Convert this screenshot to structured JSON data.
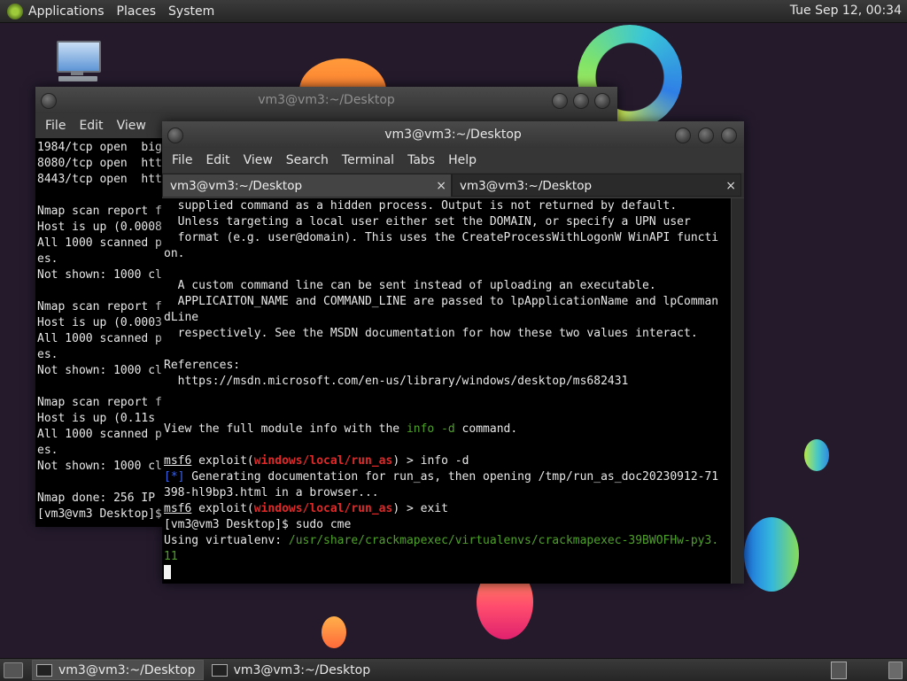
{
  "top_panel": {
    "menus": [
      "Applications",
      "Places",
      "System"
    ],
    "clock": "Tue Sep 12, 00:34"
  },
  "back_window": {
    "title": "vm3@vm3:~/Desktop",
    "menus": [
      "File",
      "Edit",
      "View"
    ],
    "lines": [
      "1984/tcp open  big",
      "8080/tcp open  htt",
      "8443/tcp open  htt",
      "",
      "Nmap scan report f",
      "Host is up (0.0008",
      "All 1000 scanned p",
      "es.",
      "Not shown: 1000 cl",
      "",
      "Nmap scan report f",
      "Host is up (0.0003",
      "All 1000 scanned p",
      "es.",
      "Not shown: 1000 cl",
      "",
      "Nmap scan report f",
      "Host is up (0.11s ",
      "All 1000 scanned p",
      "es.",
      "Not shown: 1000 cl",
      "",
      "Nmap done: 256 IP ",
      "[vm3@vm3 Desktop]$"
    ]
  },
  "front_window": {
    "title": "vm3@vm3:~/Desktop",
    "menus": [
      "File",
      "Edit",
      "View",
      "Search",
      "Terminal",
      "Tabs",
      "Help"
    ],
    "tabs": [
      {
        "label": "vm3@vm3:~/Desktop",
        "close": "×"
      },
      {
        "label": "vm3@vm3:~/Desktop",
        "close": "×"
      }
    ],
    "lines": {
      "l1": "  supplied command as a hidden process. Output is not returned by default.",
      "l2": "  Unless targeting a local user either set the DOMAIN, or specify a UPN user",
      "l3": "  format (e.g. user@domain). This uses the CreateProcessWithLogonW WinAPI functi",
      "l4": "on.",
      "l5": "",
      "l6": "  A custom command line can be sent instead of uploading an executable.",
      "l7": "  APPLICAITON_NAME and COMMAND_LINE are passed to lpApplicationName and lpComman",
      "l8": "dLine",
      "l9": "  respectively. See the MSDN documentation for how these two values interact.",
      "l10": "",
      "l11": "References:",
      "l12": "  https://msdn.microsoft.com/en-us/library/windows/desktop/ms682431",
      "l13": "",
      "l14": "",
      "l15_pre": "View the full module info with the ",
      "l15_cmd": "info -d",
      "l15_post": " command.",
      "l16": "",
      "prompt_msf": "msf6",
      "prompt_exploit": " exploit(",
      "prompt_module": "windows/local/run_as",
      "prompt_end": ") > ",
      "cmd1": "info -d",
      "gen_tag": "[*]",
      "gen_text": " Generating documentation for run_as, then opening /tmp/run_as_doc20230912-71",
      "gen_text2": "398-hl9bp3.html in a browser...",
      "cmd2": "exit",
      "shell_prompt": "[vm3@vm3 Desktop]$ sudo cme",
      "venv_label": "Using virtualenv: ",
      "venv_path": "/usr/share/crackmapexec/virtualenvs/crackmapexec-39BWOFHw-py3.",
      "venv_path2": "11"
    }
  },
  "taskbar": {
    "tasks": [
      "vm3@vm3:~/Desktop",
      "vm3@vm3:~/Desktop"
    ]
  }
}
